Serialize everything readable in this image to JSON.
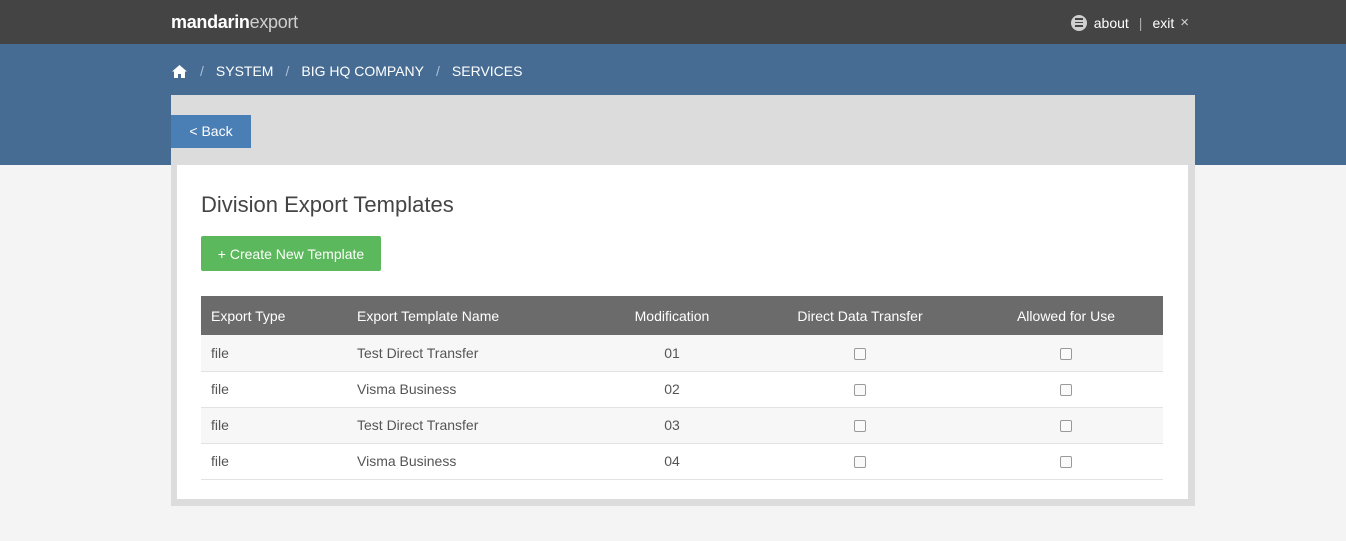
{
  "app": {
    "logo_bold": "mandarin",
    "logo_light": "export"
  },
  "toplinks": {
    "about": "about",
    "separator": "|",
    "exit": "exit",
    "exit_icon": "×"
  },
  "breadcrumb": {
    "items": [
      "SYSTEM",
      "BIG HQ COMPANY",
      "SERVICES"
    ],
    "separator": "/"
  },
  "panel": {
    "back_label": "< Back",
    "title": "Division Export Templates",
    "create_label": "+ Create New Template"
  },
  "table": {
    "columns": [
      "Export Type",
      "Export Template Name",
      "Modification",
      "Direct Data Transfer",
      "Allowed for Use"
    ],
    "rows": [
      {
        "type": "file",
        "name": "Test Direct Transfer",
        "modification": "01",
        "direct": false,
        "allowed": false
      },
      {
        "type": "file",
        "name": "Visma Business",
        "modification": "02",
        "direct": false,
        "allowed": false
      },
      {
        "type": "file",
        "name": "Test Direct Transfer",
        "modification": "03",
        "direct": false,
        "allowed": false
      },
      {
        "type": "file",
        "name": "Visma Business",
        "modification": "04",
        "direct": false,
        "allowed": false
      }
    ]
  },
  "icons": {
    "home": "home-icon",
    "menu": "menu-icon",
    "close": "close-icon"
  },
  "colors": {
    "topbar": "#444444",
    "band": "#466c94",
    "back_button": "#4a7fb5",
    "create_button": "#5cb85c",
    "table_header": "#6b6b6b"
  }
}
